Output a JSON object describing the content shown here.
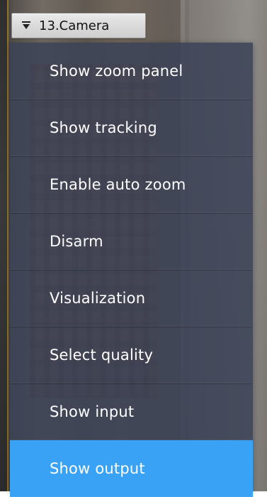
{
  "camera": {
    "title": "13.Camera",
    "dropdown_icon": "dropdown-icon"
  },
  "menu": {
    "items": [
      {
        "label": "Show zoom panel",
        "selected": false
      },
      {
        "label": "Show tracking",
        "selected": false
      },
      {
        "label": "Enable auto zoom",
        "selected": false
      },
      {
        "label": "Disarm",
        "selected": false
      },
      {
        "label": "Visualization",
        "selected": false
      },
      {
        "label": "Select quality",
        "selected": false
      },
      {
        "label": "Show input",
        "selected": false
      },
      {
        "label": "Show output",
        "selected": true
      }
    ],
    "selected_color": "#3aa2f4",
    "panel_color": "#3a4256"
  }
}
